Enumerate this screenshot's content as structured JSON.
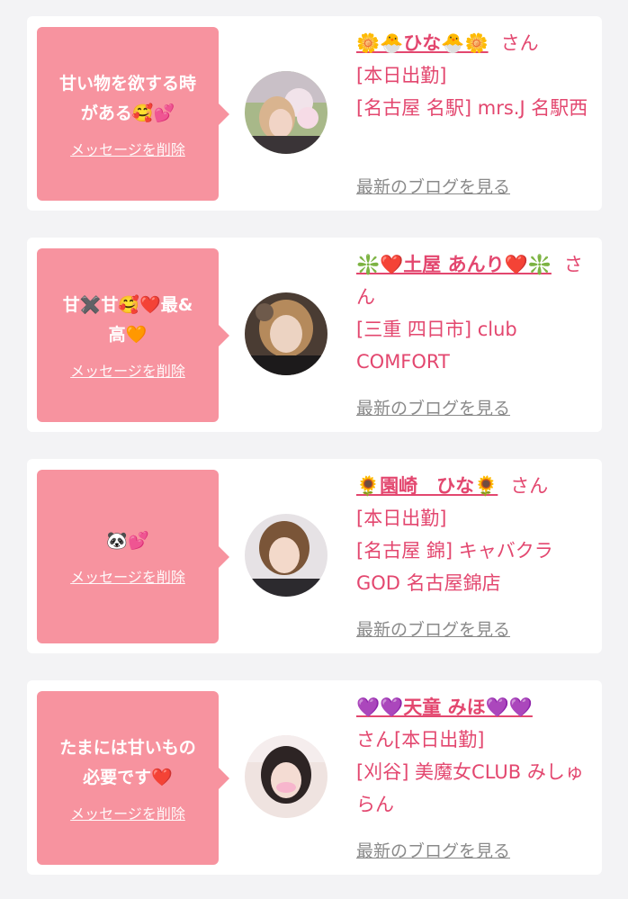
{
  "cards": [
    {
      "message": "甘い物を欲する時\nがある🥰💕",
      "delete_label": "メッセージを削除",
      "name": "🌼🐣ひな🐣🌼",
      "san": "さん",
      "status": "[本日出勤]",
      "shop": "[名古屋 名駅] mrs.J 名駅西",
      "blog_label": "最新のブログを見る"
    },
    {
      "message": "甘✖️甘🥰❤️最&\n高🧡",
      "delete_label": "メッセージを削除",
      "name": "❇️❤️土屋 あんり❤️❇️",
      "san": "さん",
      "status": "",
      "shop": "[三重 四日市] club COMFORT",
      "blog_label": "最新のブログを見る"
    },
    {
      "message": "🐼💕",
      "delete_label": "メッセージを削除",
      "name": "🌻園崎　ひな🌻",
      "san": "さん",
      "status": "[本日出勤]",
      "shop": "[名古屋 錦] キャバクラ GOD 名古屋錦店",
      "blog_label": "最新のブログを見る"
    },
    {
      "message": "たまには甘いもの\n必要です❤️",
      "delete_label": "メッセージを削除",
      "name": "💜💜天童 みほ💜💜",
      "san": "さん",
      "status": "[本日出勤]",
      "shop": "[刈谷] 美魔女CLUB みしゅらん",
      "blog_label": "最新のブログを見る"
    }
  ]
}
